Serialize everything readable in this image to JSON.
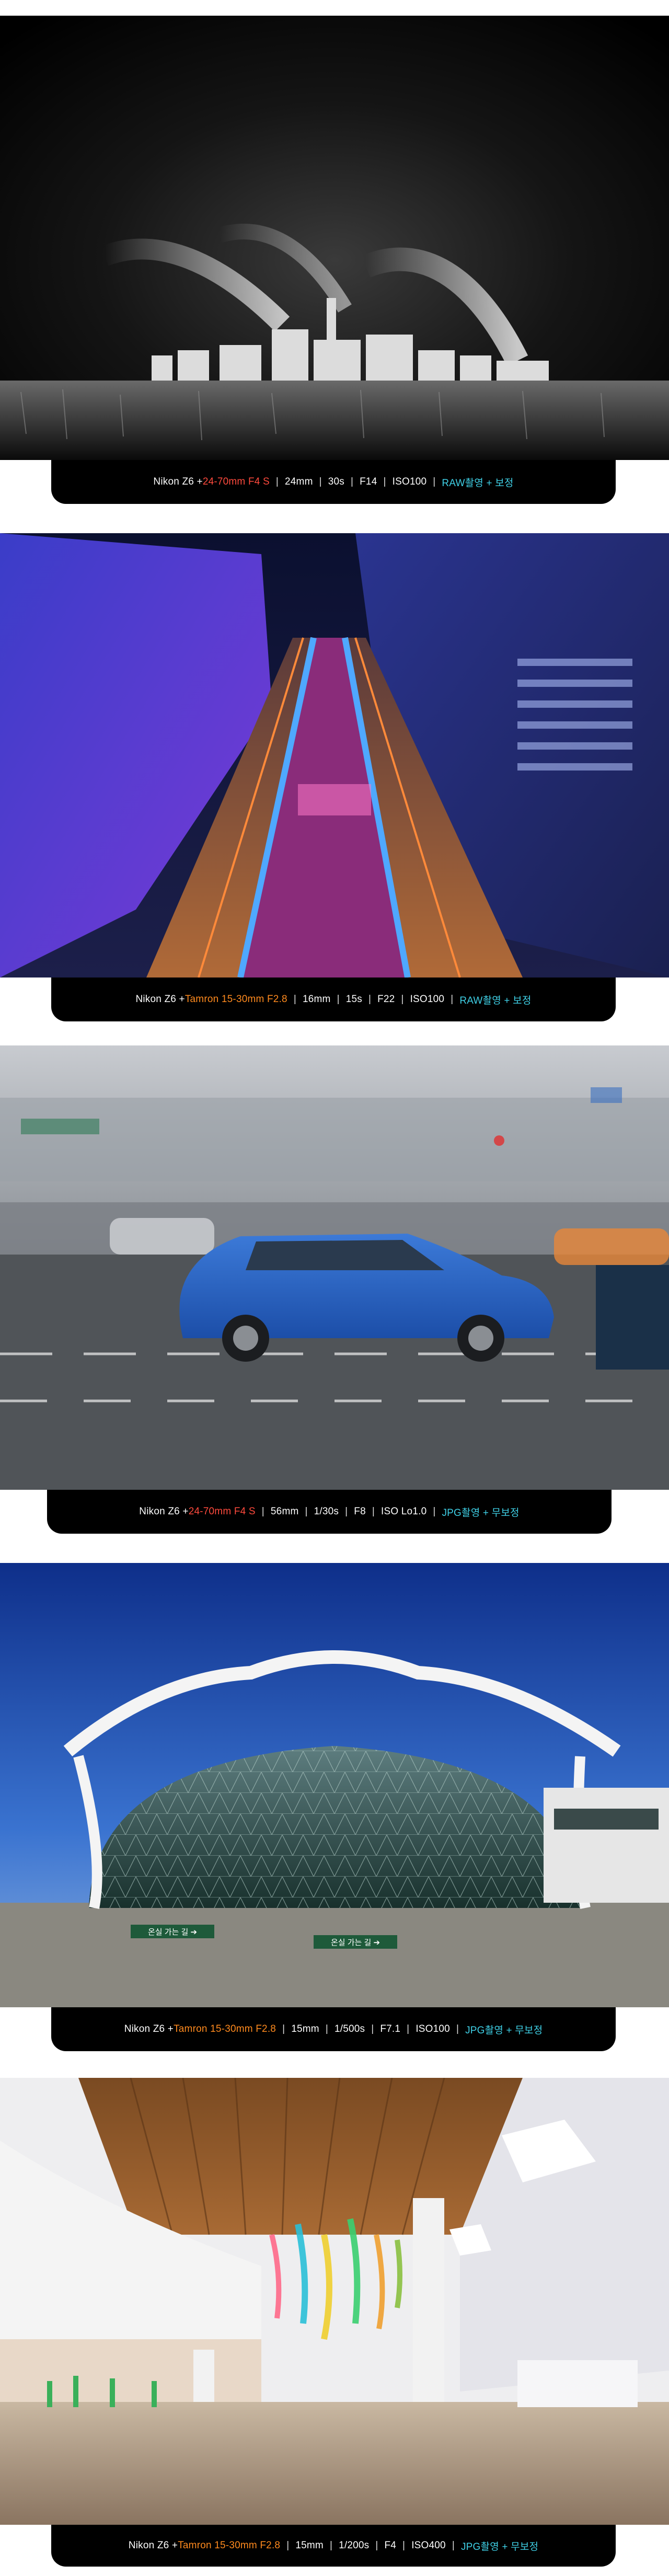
{
  "colors": {
    "lens_red": "#ff4a3d",
    "lens_orange": "#ff8a1e",
    "mode_cyan": "#3fd0e6",
    "bar_bg": "#000000"
  },
  "captions": [
    {
      "camera": "Nikon Z6 + ",
      "lens": "24-70mm F4 S",
      "lens_color": "#ff4a3d",
      "focal": "24mm",
      "shutter": "30s",
      "aperture": "F14",
      "iso": "ISO100",
      "mode": "RAW촬영 + 보정"
    },
    {
      "camera": "Nikon Z6 + ",
      "lens": "Tamron 15-30mm F2.8",
      "lens_color": "#ff8a1e",
      "focal": "16mm",
      "shutter": "15s",
      "aperture": "F22",
      "iso": "ISO100",
      "mode": "RAW촬영 + 보정"
    },
    {
      "camera": "Nikon Z6 + ",
      "lens": "24-70mm F4 S",
      "lens_color": "#ff4a3d",
      "focal": "56mm",
      "shutter": "1/30s",
      "aperture": "F8",
      "iso": "ISO Lo1.0",
      "mode": "JPG촬영 + 무보정"
    },
    {
      "camera": "Nikon Z6 + ",
      "lens": "Tamron 15-30mm F2.8",
      "lens_color": "#ff8a1e",
      "focal": "15mm",
      "shutter": "1/500s",
      "aperture": "F7.1",
      "iso": "ISO100",
      "mode": "JPG촬영 + 무보정"
    },
    {
      "camera": "Nikon Z6 + ",
      "lens": "Tamron 15-30mm F2.8",
      "lens_color": "#ff8a1e",
      "focal": "15mm",
      "shutter": "1/200s",
      "aperture": "F4",
      "iso": "ISO400",
      "mode": "JPG촬영 + 무보정"
    }
  ],
  "signs": {
    "dome_left": "온실 가는 길 ➔",
    "dome_right": "온실 가는 길 ➔"
  }
}
